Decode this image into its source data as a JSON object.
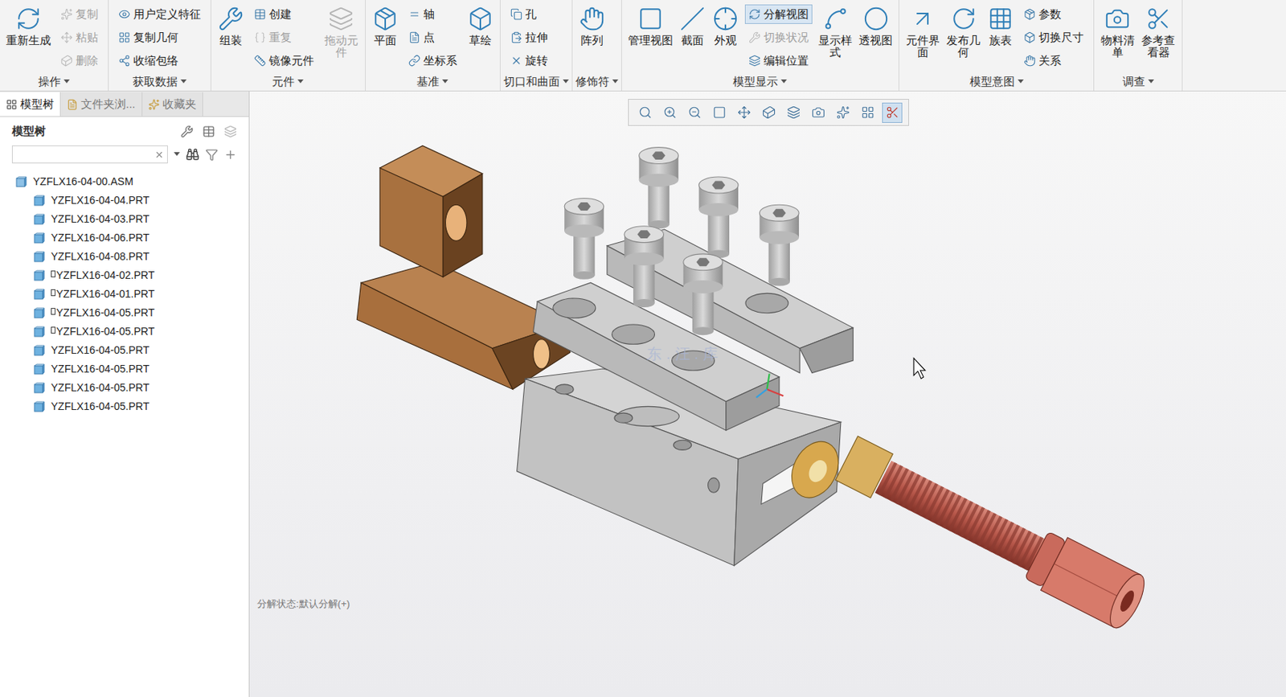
{
  "window": {
    "title": "YZFLX16-04-00.ASM"
  },
  "ribbon": {
    "groups": [
      {
        "label": "操作",
        "columns": [
          {
            "kind": "large",
            "label": "重新生成",
            "disabled": false
          },
          {
            "kind": "stack",
            "items": [
              {
                "label": "复制",
                "disabled": true
              },
              {
                "label": "粘贴",
                "disabled": true
              },
              {
                "label": "删除",
                "disabled": true
              }
            ]
          }
        ]
      },
      {
        "label": "获取数据",
        "columns": [
          {
            "kind": "stack",
            "items": [
              {
                "label": "用户定义特征",
                "disabled": false
              },
              {
                "label": "复制几何",
                "disabled": false
              },
              {
                "label": "收缩包络",
                "disabled": false
              }
            ]
          }
        ]
      },
      {
        "label": "元件",
        "columns": [
          {
            "kind": "large",
            "label": "组装",
            "disabled": false
          },
          {
            "kind": "stack",
            "items": [
              {
                "label": "创建",
                "disabled": false
              },
              {
                "label": "重复",
                "disabled": true
              },
              {
                "label": "镜像元件",
                "disabled": false
              }
            ]
          },
          {
            "kind": "large-wrap",
            "label": "拖动元件",
            "disabled": true
          }
        ]
      },
      {
        "label": "基准",
        "columns": [
          {
            "kind": "large",
            "label": "平面",
            "disabled": false
          },
          {
            "kind": "stack",
            "items": [
              {
                "label": "轴",
                "disabled": false
              },
              {
                "label": "点",
                "disabled": false
              },
              {
                "label": "坐标系",
                "disabled": false
              }
            ]
          },
          {
            "kind": "large",
            "label": "草绘",
            "disabled": false
          }
        ]
      },
      {
        "label": "切口和曲面",
        "columns": [
          {
            "kind": "stack",
            "items": [
              {
                "label": "孔",
                "disabled": false
              },
              {
                "label": "拉伸",
                "disabled": false
              },
              {
                "label": "旋转",
                "disabled": false
              }
            ]
          }
        ]
      },
      {
        "label": "修饰符",
        "columns": [
          {
            "kind": "large",
            "label": "阵列",
            "disabled": false
          }
        ]
      },
      {
        "label": "模型显示",
        "columns": [
          {
            "kind": "large",
            "label": "管理视图",
            "disabled": false
          },
          {
            "kind": "large",
            "label": "截面",
            "disabled": false
          },
          {
            "kind": "large",
            "label": "外观",
            "disabled": false
          },
          {
            "kind": "stack",
            "items": [
              {
                "label": "分解视图",
                "disabled": false,
                "selected": true
              },
              {
                "label": "切换状况",
                "disabled": true
              },
              {
                "label": "编辑位置",
                "disabled": false
              }
            ]
          },
          {
            "kind": "large-wrap",
            "label": "显示样式",
            "disabled": false
          },
          {
            "kind": "large",
            "label": "透视图",
            "disabled": false
          }
        ]
      },
      {
        "label": "模型意图",
        "columns": [
          {
            "kind": "large-wrap",
            "label": "元件界面",
            "disabled": false
          },
          {
            "kind": "large-wrap",
            "label": "发布几何",
            "disabled": false
          },
          {
            "kind": "large",
            "label": "族表",
            "disabled": false
          },
          {
            "kind": "stack",
            "items": [
              {
                "label": "参数",
                "disabled": false
              },
              {
                "label": "切换尺寸",
                "disabled": false
              },
              {
                "label": "关系",
                "disabled": false
              }
            ]
          }
        ]
      },
      {
        "label": "调查",
        "columns": [
          {
            "kind": "large-wrap",
            "label": "物料清单",
            "disabled": false
          },
          {
            "kind": "large-wrap",
            "label": "参考查看器",
            "disabled": false
          }
        ]
      }
    ]
  },
  "panel": {
    "tabs": [
      {
        "label": "模型树",
        "selected": true
      },
      {
        "label": "文件夹浏...",
        "selected": false
      },
      {
        "label": "收藏夹",
        "selected": false
      }
    ],
    "header": "模型树",
    "search": {
      "value": ""
    },
    "tree": [
      {
        "label": "YZFLX16-04-00.ASM",
        "kind": "assembly",
        "flag": false
      },
      {
        "label": "YZFLX16-04-04.PRT",
        "kind": "part",
        "flag": false
      },
      {
        "label": "YZFLX16-04-03.PRT",
        "kind": "part",
        "flag": false
      },
      {
        "label": "YZFLX16-04-06.PRT",
        "kind": "part",
        "flag": false
      },
      {
        "label": "YZFLX16-04-08.PRT",
        "kind": "part",
        "flag": false
      },
      {
        "label": "YZFLX16-04-02.PRT",
        "kind": "part",
        "flag": true
      },
      {
        "label": "YZFLX16-04-01.PRT",
        "kind": "part",
        "flag": true
      },
      {
        "label": "YZFLX16-04-05.PRT",
        "kind": "part",
        "flag": true
      },
      {
        "label": "YZFLX16-04-05.PRT",
        "kind": "part",
        "flag": true
      },
      {
        "label": "YZFLX16-04-05.PRT",
        "kind": "part",
        "flag": false
      },
      {
        "label": "YZFLX16-04-05.PRT",
        "kind": "part",
        "flag": false
      },
      {
        "label": "YZFLX16-04-05.PRT",
        "kind": "part",
        "flag": false
      },
      {
        "label": "YZFLX16-04-05.PRT",
        "kind": "part",
        "flag": false
      }
    ]
  },
  "viewport": {
    "toolbar": [
      {
        "selected": false
      },
      {
        "selected": false
      },
      {
        "selected": false
      },
      {
        "selected": false
      },
      {
        "selected": false
      },
      {
        "selected": false
      },
      {
        "selected": false
      },
      {
        "selected": false
      },
      {
        "selected": false
      },
      {
        "selected": false
      },
      {
        "selected": true
      }
    ],
    "watermark": "东.汪.库",
    "status": "分解状态:默认分解(+)"
  }
}
